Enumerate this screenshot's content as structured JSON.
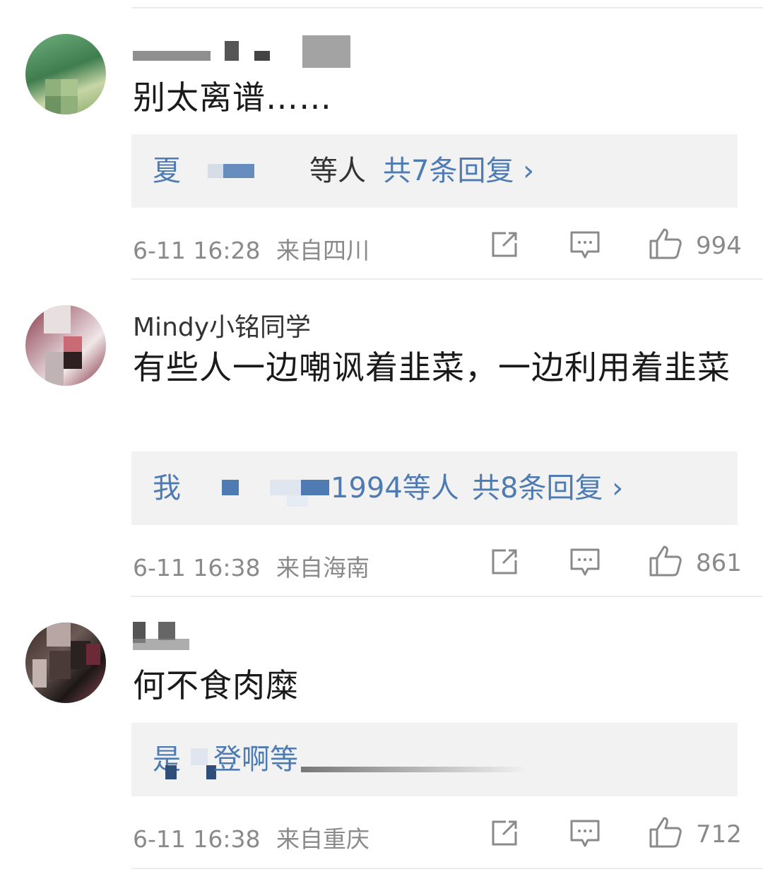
{
  "comments": [
    {
      "username": "",
      "content": "别太离谱……",
      "reply": {
        "prefix": "夏",
        "suffix": "等人",
        "link": "共7条回复 ›"
      },
      "time": "6-11 16:28",
      "location": "来自四川",
      "likes": "994"
    },
    {
      "username": "Mindy小铭同学",
      "content": "有些人一边嘲讽着韭菜，一边利用着韭菜",
      "reply": {
        "prefix": "我",
        "suffix": "1994等人",
        "link": "共8条回复 ›"
      },
      "time": "6-11 16:38",
      "location": "来自海南",
      "likes": "861"
    },
    {
      "username": "",
      "content": "何不食肉糜",
      "reply": {
        "prefix": "是",
        "suffix": "登啊等",
        "link": ""
      },
      "time": "6-11 16:38",
      "location": "来自重庆",
      "likes": "712"
    }
  ],
  "icons": {
    "share": "share-icon",
    "comment": "comment-icon",
    "like": "thumbs-up-icon"
  },
  "colors": {
    "link_blue": "#4f7bb3",
    "meta_gray": "#8a8a8a",
    "reply_bg": "#f2f2f2"
  }
}
